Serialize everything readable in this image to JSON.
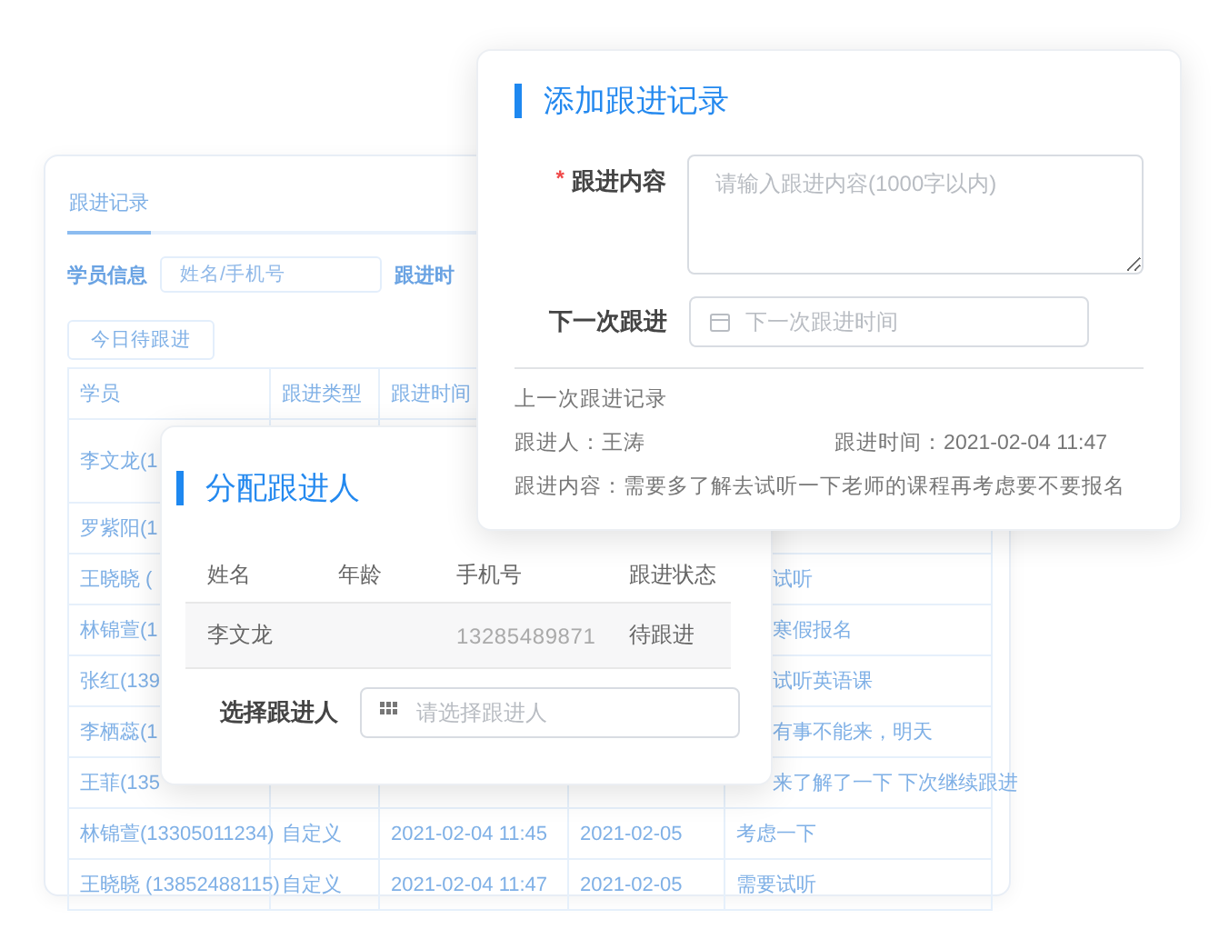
{
  "records_panel": {
    "tab": {
      "label": "跟进记录",
      "selected": true
    },
    "filter_label": "学员信息",
    "search": {
      "placeholder": "姓名/手机号"
    },
    "filter_label_2": "跟进时",
    "today_button": "今日待跟进",
    "table": {
      "columns": [
        "学员",
        "跟进类型",
        "跟进时间"
      ],
      "rows": [
        {
          "student": "李文龙(1"
        },
        {
          "student": "罗紫阳(1"
        },
        {
          "student": "王晓晓 (",
          "column_5": "试听"
        },
        {
          "student": "林锦萱(1",
          "column_5": "寒假报名"
        },
        {
          "student": "张红(139",
          "column_5": "试听英语课"
        },
        {
          "student": "李栖蕊(1",
          "column_5": "有事不能来，明天"
        },
        {
          "student": "王菲(135",
          "column_5": "来了解了一下 下次继续跟进"
        },
        {
          "student": "林锦萱(13305011234)",
          "type": "自定义",
          "time": "2021-02-04 11:45",
          "column_4": "2021-02-05",
          "column_5": "考虑一下"
        },
        {
          "student": "王晓晓 (13852488115)",
          "type": "自定义",
          "time": "2021-02-04 11:47",
          "column_4": "2021-02-05",
          "column_5": "需要试听"
        }
      ]
    }
  },
  "add_record_dialog": {
    "title": "添加跟进记录",
    "required_mark": "*",
    "content_label": "跟进内容",
    "content_field": {
      "placeholder": "请输入跟进内容(1000字以内)"
    },
    "next_label": "下一次跟进",
    "next_field": {
      "placeholder": "下一次跟进时间"
    },
    "last_record": {
      "heading": "上一次跟进记录",
      "follower": "跟进人：王涛",
      "time": "跟进时间：2021-02-04 11:47",
      "content": "跟进内容：需要多了解去试听一下老师的课程再考虑要不要报名"
    }
  },
  "assign_dialog": {
    "title": "分配跟进人",
    "table": {
      "columns": [
        "姓名",
        "年龄",
        "手机号",
        "跟进状态"
      ],
      "rows": [
        {
          "name": "李文龙",
          "phone": "13285489871",
          "status": "待跟进"
        }
      ]
    },
    "select_label": "选择跟进人",
    "select_field": {
      "placeholder": "请选择跟进人"
    }
  }
}
